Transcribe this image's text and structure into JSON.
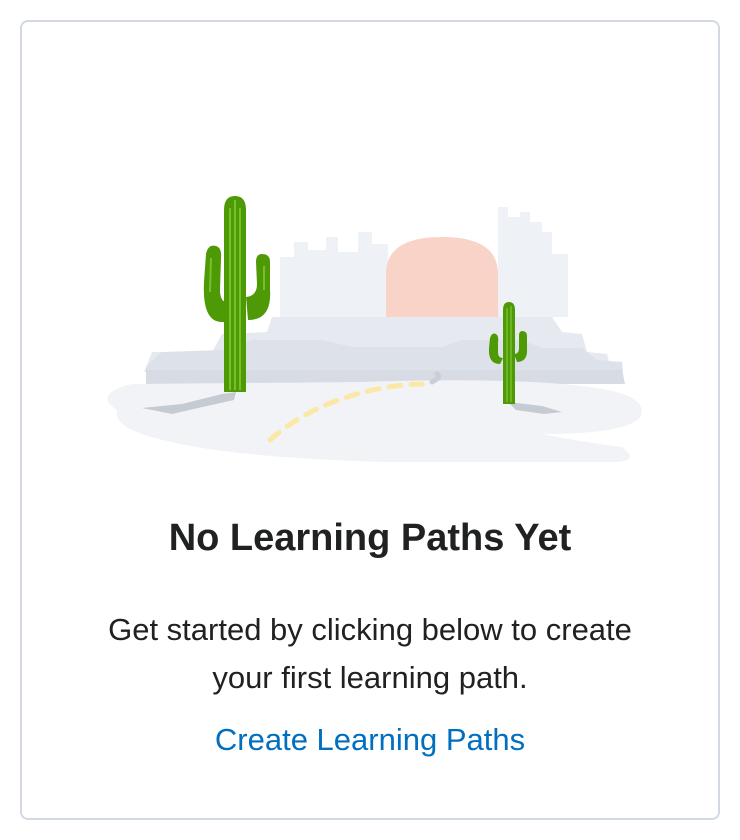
{
  "empty_state": {
    "title": "No Learning Paths Yet",
    "description": "Get started by clicking below to create your first learning path.",
    "action_label": "Create Learning Paths",
    "illustration": "desert-cactus-illustration"
  },
  "colors": {
    "card_border": "#d3d9e3",
    "title_text": "#202122",
    "link": "#006fbf",
    "cactus": "#4e9a06",
    "sun": "#f9d2c8",
    "path_dashes": "#fbe7a6"
  }
}
